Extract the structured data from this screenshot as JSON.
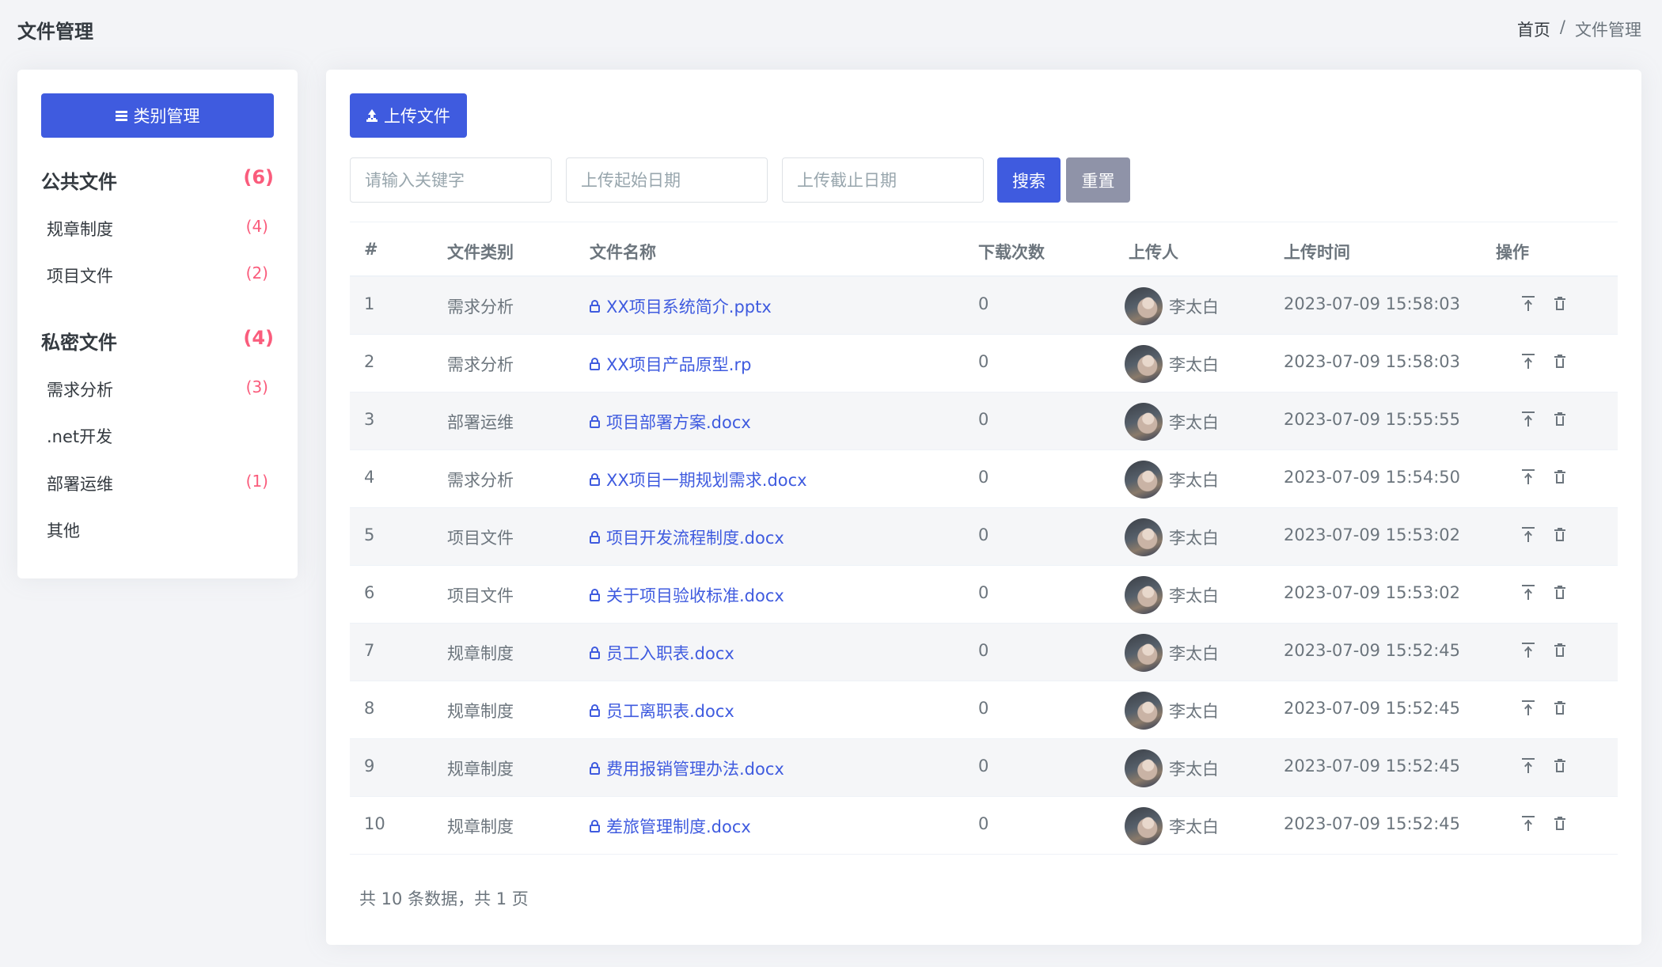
{
  "header": {
    "title": "文件管理",
    "breadcrumb": {
      "home": "首页",
      "sep": "/",
      "current": "文件管理"
    }
  },
  "sidebar": {
    "button_label": "类别管理",
    "groups": [
      {
        "label": "公共文件",
        "count": "(6)",
        "items": [
          {
            "label": "规章制度",
            "count": "(4)"
          },
          {
            "label": "项目文件",
            "count": "(2)"
          }
        ]
      },
      {
        "label": "私密文件",
        "count": "(4)",
        "items": [
          {
            "label": "需求分析",
            "count": "(3)"
          },
          {
            "label": ".net开发",
            "count": ""
          },
          {
            "label": "部署运维",
            "count": "(1)"
          },
          {
            "label": "其他",
            "count": ""
          }
        ]
      }
    ]
  },
  "toolbar": {
    "upload_label": "上传文件",
    "keyword_placeholder": "请输入关键字",
    "start_placeholder": "上传起始日期",
    "end_placeholder": "上传截止日期",
    "search_label": "搜索",
    "reset_label": "重置"
  },
  "table": {
    "headers": [
      "#",
      "文件类别",
      "文件名称",
      "下载次数",
      "上传人",
      "上传时间",
      "操作"
    ],
    "rows": [
      {
        "index": "1",
        "category": "需求分析",
        "name": "XX项目系统简介.pptx",
        "downloads": "0",
        "uploader": "李太白",
        "time": "2023-07-09 15:58:03"
      },
      {
        "index": "2",
        "category": "需求分析",
        "name": "XX项目产品原型.rp",
        "downloads": "0",
        "uploader": "李太白",
        "time": "2023-07-09 15:58:03"
      },
      {
        "index": "3",
        "category": "部署运维",
        "name": "项目部署方案.docx",
        "downloads": "0",
        "uploader": "李太白",
        "time": "2023-07-09 15:55:55"
      },
      {
        "index": "4",
        "category": "需求分析",
        "name": "XX项目一期规划需求.docx",
        "downloads": "0",
        "uploader": "李太白",
        "time": "2023-07-09 15:54:50"
      },
      {
        "index": "5",
        "category": "项目文件",
        "name": "项目开发流程制度.docx",
        "downloads": "0",
        "uploader": "李太白",
        "time": "2023-07-09 15:53:02"
      },
      {
        "index": "6",
        "category": "项目文件",
        "name": "关于项目验收标准.docx",
        "downloads": "0",
        "uploader": "李太白",
        "time": "2023-07-09 15:53:02"
      },
      {
        "index": "7",
        "category": "规章制度",
        "name": "员工入职表.docx",
        "downloads": "0",
        "uploader": "李太白",
        "time": "2023-07-09 15:52:45"
      },
      {
        "index": "8",
        "category": "规章制度",
        "name": "员工离职表.docx",
        "downloads": "0",
        "uploader": "李太白",
        "time": "2023-07-09 15:52:45"
      },
      {
        "index": "9",
        "category": "规章制度",
        "name": "费用报销管理办法.docx",
        "downloads": "0",
        "uploader": "李太白",
        "time": "2023-07-09 15:52:45"
      },
      {
        "index": "10",
        "category": "规章制度",
        "name": "差旅管理制度.docx",
        "downloads": "0",
        "uploader": "李太白",
        "time": "2023-07-09 15:52:45"
      }
    ]
  },
  "pagination": {
    "summary": "共 10 条数据，共 1 页"
  },
  "icons": {
    "category_button": "menu-icon",
    "upload": "upload-icon",
    "file": "lock-icon",
    "row_actions": [
      "pin-top-icon",
      "trash-icon"
    ]
  },
  "colors": {
    "primary": "#3f5bdf",
    "reset": "#8f93a8",
    "count": "#fa5c7c",
    "background": "#f3f4f7"
  }
}
